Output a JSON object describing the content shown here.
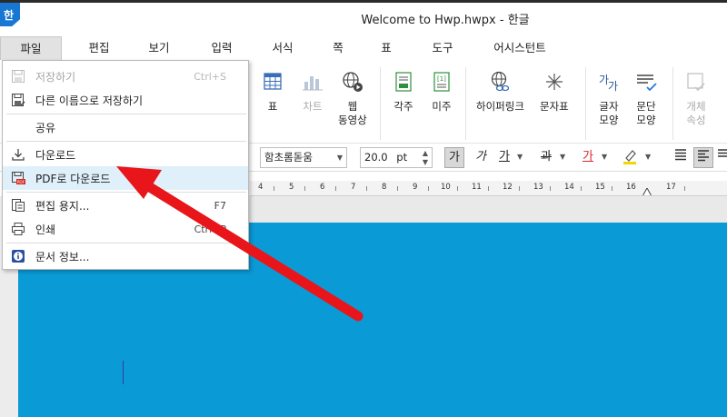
{
  "window": {
    "title": "Welcome to Hwp.hwpx - 한글",
    "logo": "한"
  },
  "menubar": {
    "items": [
      "파일",
      "편집",
      "보기",
      "입력",
      "서식",
      "쪽",
      "표",
      "도구",
      "어시스턴트"
    ],
    "active": "파일"
  },
  "ribbon": {
    "table": "표",
    "chart": "차트",
    "web_video": "웹\n동영상",
    "footnote": "각주",
    "endnote": "미주",
    "hyperlink": "하이퍼링크",
    "symbol": "문자표",
    "char_shape": "글자\n모양",
    "para_shape": "문단\n모양",
    "object_props": "개체\n속성"
  },
  "format_bar": {
    "font": "함초롬돋움",
    "size": "20.0",
    "size_unit": "pt",
    "bold_glyph": "가",
    "italic_glyph": "가",
    "underline_glyph": "가",
    "strike_glyph": "과",
    "color_glyph": "가"
  },
  "ruler": {
    "labels": [
      "4",
      "5",
      "6",
      "7",
      "8",
      "9",
      "10",
      "11",
      "12",
      "13",
      "14",
      "15",
      "16",
      "17"
    ]
  },
  "file_menu": {
    "save": "저장하기",
    "save_shortcut": "Ctrl+S",
    "save_as": "다른 이름으로 저장하기",
    "share": "공유",
    "download": "다운로드",
    "download_pdf": "PDF로 다운로드",
    "page_setup": "편집 용지...",
    "page_setup_shortcut": "F7",
    "print": "인쇄",
    "print_shortcut": "Ctrl+P",
    "doc_info": "문서 정보..."
  },
  "colors": {
    "accent": "#1877d2",
    "document": "#0a9ad6",
    "arrow": "#e8161a"
  }
}
